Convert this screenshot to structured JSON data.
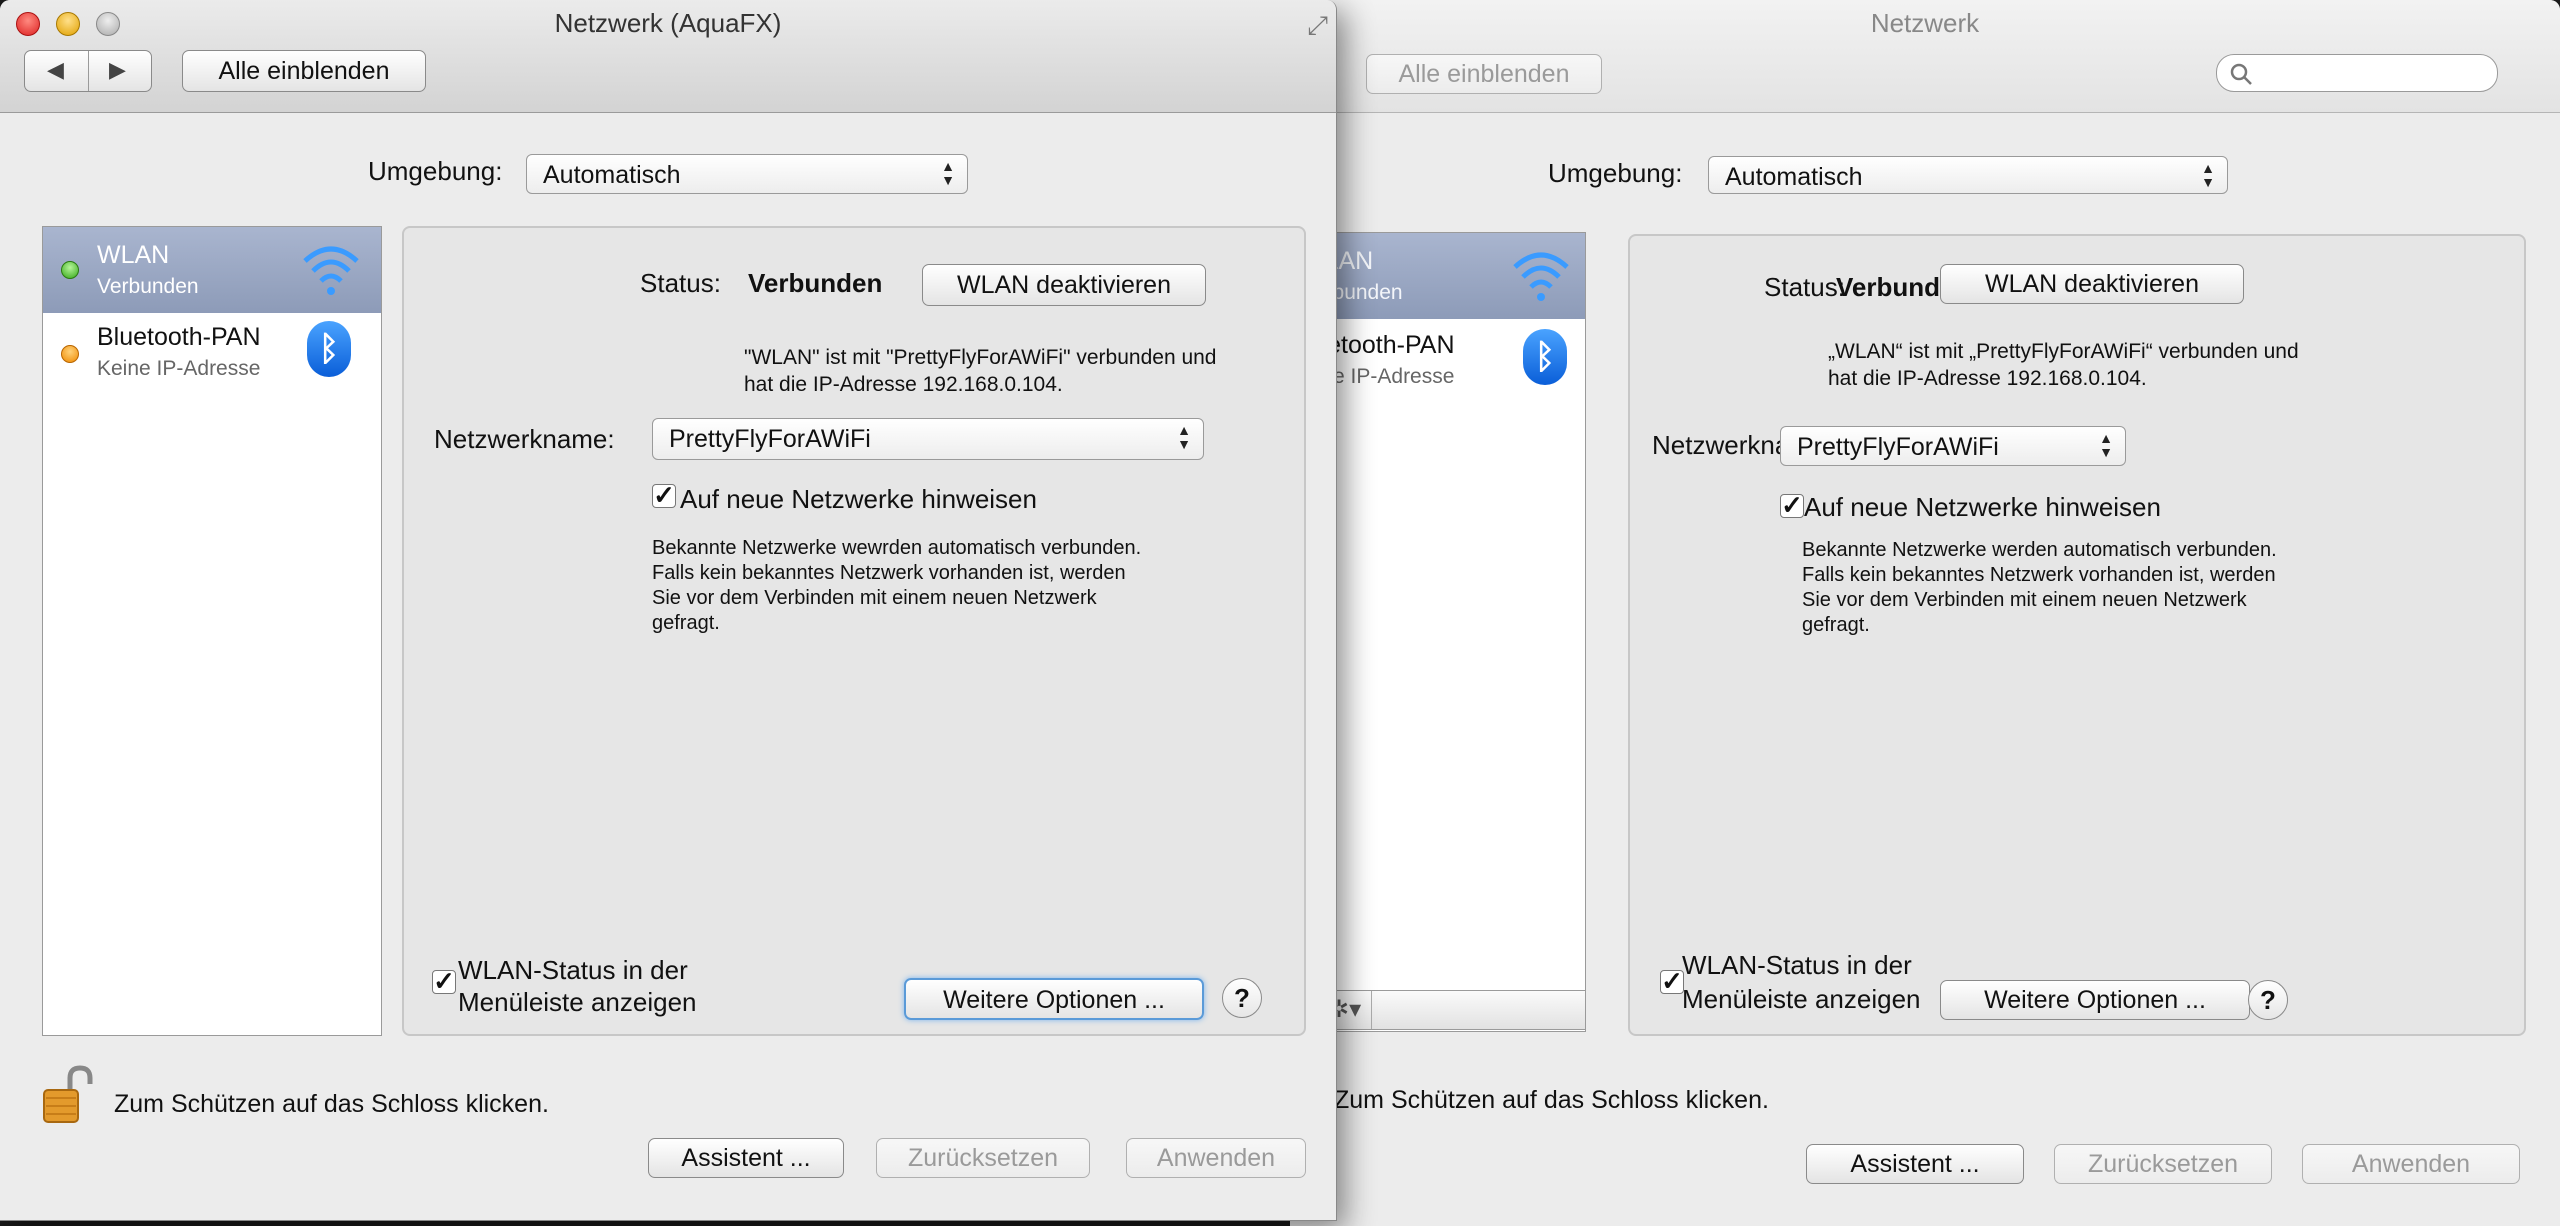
{
  "front": {
    "title": "Netzwerk (AquaFX)",
    "show_all": "Alle einblenden",
    "nav_back": "◀",
    "nav_forward": "▶",
    "fullscreen_icon": "⤢",
    "location_label": "Umgebung:",
    "location_value": "Automatisch",
    "services": [
      {
        "name": "WLAN",
        "status": "Verbunden",
        "dot": "green",
        "icon": "wifi-icon"
      },
      {
        "name": "Bluetooth-PAN",
        "status": "Keine IP-Adresse",
        "dot": "orange",
        "icon": "bluetooth-icon",
        "glyph": "ᛒ"
      }
    ],
    "status_label": "Status:",
    "status_value": "Verbunden",
    "toggle_wifi": "WLAN deaktivieren",
    "status_info_1": "\"WLAN\" ist mit \"PrettyFlyForAWiFi\" verbunden und",
    "status_info_2": " hat die IP-Adresse 192.168.0.104.",
    "network_name_label": "Netzwerkname:",
    "network_name_value": "PrettyFlyForAWiFi",
    "ask_join_label": "Auf neue Netzwerke hinweisen",
    "ask_join_check": "✓",
    "ask_join_info_1": "Bekannte Netzwerke wewrden automatisch verbunden.",
    "ask_join_info_2": "Falls kein bekanntes Netzwerk vorhanden ist, werden",
    "ask_join_info_3": "Sie vor dem Verbinden mit einem neuen Netzwerk",
    "ask_join_info_4": "gefragt.",
    "menubar_check": "✓",
    "menubar_label_1": "WLAN-Status in der",
    "menubar_label_2": "Menüleiste anzeigen",
    "advanced": "Weitere Optionen ...",
    "help": "?",
    "lock_text": "Zum Schützen auf das Schloss klicken.",
    "assistant": "Assistent ...",
    "revert": "Zurücksetzen",
    "apply": "Anwenden"
  },
  "back": {
    "title": "Netzwerk",
    "show_all": "Alle einblenden",
    "search_placeholder": "",
    "location_label": "Umgebung:",
    "location_value": "Automatisch",
    "services": [
      {
        "name": "WLAN",
        "status": "Verbunden"
      },
      {
        "name": "Bluetooth-PAN",
        "status": "Keine IP-Adresse",
        "glyph": "ᛒ"
      }
    ],
    "remove": "–",
    "gear": "✲▾",
    "status_label": "Status:",
    "status_value": "Verbunden",
    "toggle_wifi": "WLAN deaktivieren",
    "status_info_1": "„WLAN“ ist mit „PrettyFlyForAWiFi“ verbunden und",
    "status_info_2": "hat die IP-Adresse 192.168.0.104.",
    "network_name_label": "Netzwerkname:",
    "network_name_value": "PrettyFlyForAWiFi",
    "ask_join_label": "Auf neue Netzwerke hinweisen",
    "ask_join_check": "✓",
    "ask_join_info_1": "Bekannte Netzwerke werden automatisch verbunden.",
    "ask_join_info_2": "Falls kein bekanntes Netzwerk vorhanden ist, werden",
    "ask_join_info_3": "Sie vor dem Verbinden mit einem neuen Netzwerk",
    "ask_join_info_4": "gefragt.",
    "menubar_check": "✓",
    "menubar_label_1": "WLAN-Status in der",
    "menubar_label_2": "Menüleiste anzeigen",
    "advanced": "Weitere Optionen ...",
    "help": "?",
    "lock_text": "Zum Schützen auf das Schloss klicken.",
    "assistant": "Assistent ...",
    "revert": "Zurücksetzen",
    "apply": "Anwenden"
  }
}
